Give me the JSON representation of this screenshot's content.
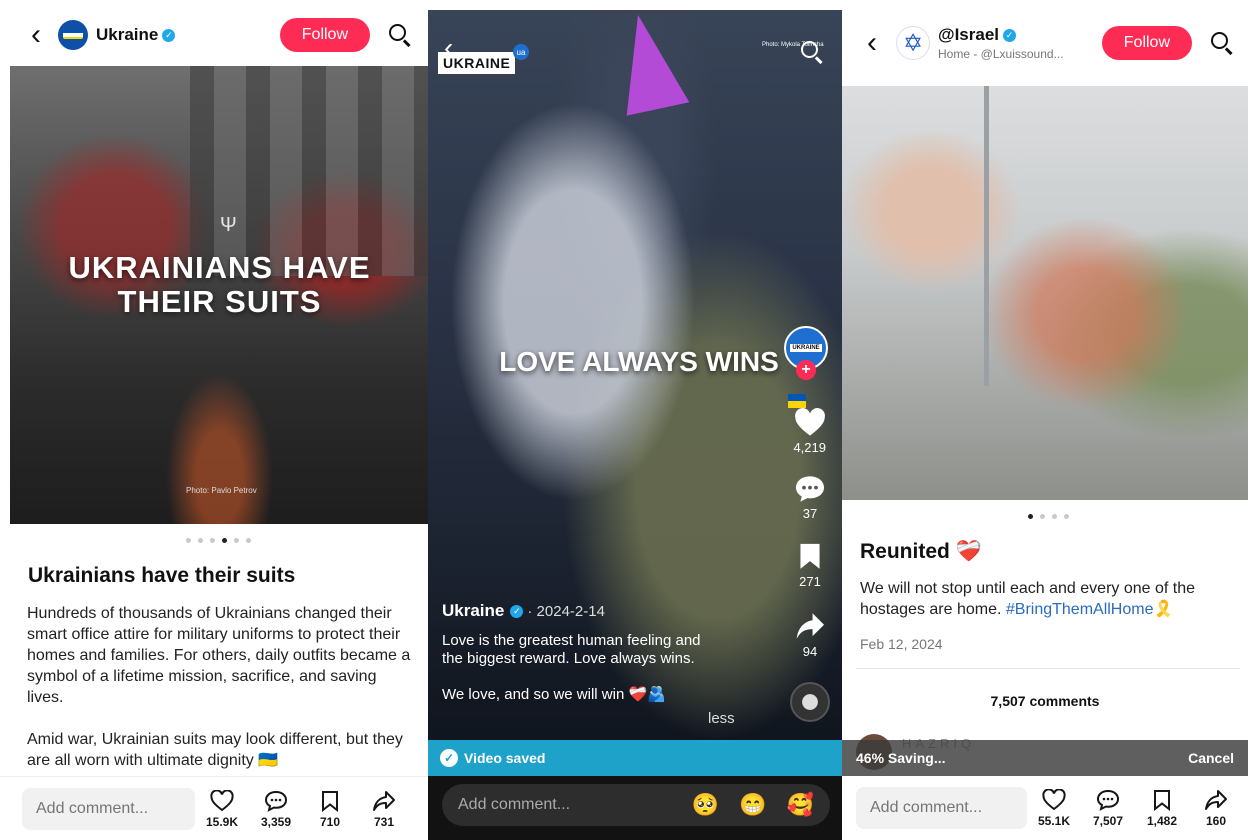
{
  "panel1": {
    "account": "Ukraine",
    "follow_label": "Follow",
    "overlay_line1": "UKRAINIANS HAVE",
    "overlay_line2": "THEIR SUITS",
    "photo_credit": "Photo: Pavlo Petrov",
    "title": "Ukrainians have their suits",
    "paragraph1": "Hundreds of thousands of Ukrainians changed their smart office attire for military uniforms to protect their homes and families. For others, daily outfits became a symbol of a lifetime mission, sacrifice, and saving lives.",
    "paragraph2": "Amid war, Ukrainian suits may look different, but they are all worn with ultimate dignity 🇺🇦",
    "comment_placeholder": "Add comment...",
    "likes": "15.9K",
    "comments": "3,359",
    "saves": "710",
    "shares": "731",
    "carousel_active": 4,
    "carousel_total": 6
  },
  "panel2": {
    "logo_text": "UKRAINE",
    "logo_badge": "ua",
    "photo_credit": "Photo: Mykola Tolincha",
    "overlay_text": "LOVE ALWAYS WINS",
    "account": "Ukraine",
    "date": "· 2024-2-14",
    "caption_line1": "Love is the greatest human feeling and",
    "caption_line2": "the biggest reward. Love always wins.",
    "caption_line3": "We love, and so we will win ❤️‍🩹🫂",
    "less_label": "less",
    "likes": "4,219",
    "comments": "37",
    "saves": "271",
    "shares": "94",
    "saved_label": "Video saved",
    "comment_placeholder": "Add comment...",
    "emojis": [
      "🥺",
      "😁",
      "🥰"
    ]
  },
  "panel3": {
    "account": "@Israel",
    "subline": "Home - @Lxuissound...",
    "follow_label": "Follow",
    "title": "Reunited ❤️‍🩹",
    "body": "We will not stop until each and every one of the hostages are home. ",
    "hashtag": "#BringThemAllHome",
    "ribbon": "🎗️",
    "date": "Feb 12, 2024",
    "comments_header": "7,507 comments",
    "hazriq": "HAZRIQ",
    "saving_label": "46% Saving...",
    "cancel_label": "Cancel",
    "comment_placeholder": "Add comment...",
    "likes": "55.1K",
    "comments": "7,507",
    "saves": "1,482",
    "shares": "160",
    "carousel_active": 1,
    "carousel_total": 4
  },
  "colors": {
    "follow": "#fe2c55",
    "verified": "#20a8ea",
    "saved_bar": "#1fa2c9",
    "hashtag": "#2a6bc2"
  },
  "icons": [
    "back-icon",
    "search-icon",
    "heart-icon",
    "comment-icon",
    "bookmark-icon",
    "share-icon",
    "check-icon",
    "plus-icon",
    "star-of-david-icon"
  ]
}
